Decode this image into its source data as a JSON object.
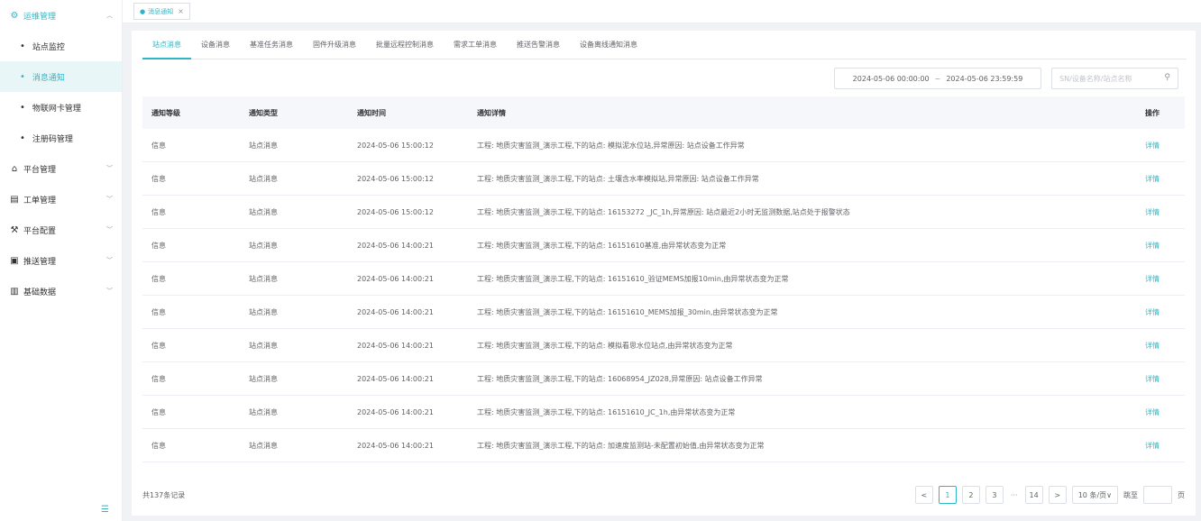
{
  "sidebar": {
    "groups": [
      {
        "label": "运维管理",
        "icon": "gear-icon",
        "open": true,
        "items": [
          {
            "label": "站点监控",
            "active": false
          },
          {
            "label": "消息通知",
            "active": true
          },
          {
            "label": "物联网卡管理",
            "active": false
          },
          {
            "label": "注册码管理",
            "active": false
          }
        ]
      },
      {
        "label": "平台管理",
        "icon": "platform-icon"
      },
      {
        "label": "工单管理",
        "icon": "workorder-icon"
      },
      {
        "label": "平台配置",
        "icon": "config-icon"
      },
      {
        "label": "推送管理",
        "icon": "push-icon"
      },
      {
        "label": "基础数据",
        "icon": "clipboard-icon"
      }
    ],
    "collapse_icon": "collapse-icon"
  },
  "tags": [
    {
      "label": "消息通知",
      "close": "×"
    }
  ],
  "tabs": [
    "站点消息",
    "设备消息",
    "基准任务消息",
    "固件升级消息",
    "批量远程控制消息",
    "需求工单消息",
    "推送告警消息",
    "设备离线通知消息"
  ],
  "filters": {
    "date_start": "2024-05-06 00:00:00",
    "date_sep": "~",
    "date_end": "2024-05-06 23:59:59",
    "search_placeholder": "SN/设备名称/站点名称"
  },
  "table": {
    "headers": {
      "level": "通知等级",
      "type": "通知类型",
      "time": "通知时间",
      "detail": "通知详情",
      "op": "操作"
    },
    "rows": [
      {
        "level": "信息",
        "type": "站点消息",
        "time": "2024-05-06 15:00:12",
        "detail": "工程: 地质灾害监测_演示工程,下的站点: 模拟泥水位站,异常原因: 站点设备工作异常",
        "op": "详情"
      },
      {
        "level": "信息",
        "type": "站点消息",
        "time": "2024-05-06 15:00:12",
        "detail": "工程: 地质灾害监测_演示工程,下的站点: 土壤含水率模拟站,异常原因: 站点设备工作异常",
        "op": "详情"
      },
      {
        "level": "信息",
        "type": "站点消息",
        "time": "2024-05-06 15:00:12",
        "detail": "工程: 地质灾害监测_演示工程,下的站点: 16153272 _JC_1h,异常原因: 站点最近2小时无监测数据,站点处于报警状态",
        "op": "详情"
      },
      {
        "level": "信息",
        "type": "站点消息",
        "time": "2024-05-06 14:00:21",
        "detail": "工程: 地质灾害监测_演示工程,下的站点: 16151610基准,由异常状态变为正常",
        "op": "详情"
      },
      {
        "level": "信息",
        "type": "站点消息",
        "time": "2024-05-06 14:00:21",
        "detail": "工程: 地质灾害监测_演示工程,下的站点: 16151610_验证MEMS加报10min,由异常状态变为正常",
        "op": "详情"
      },
      {
        "level": "信息",
        "type": "站点消息",
        "time": "2024-05-06 14:00:21",
        "detail": "工程: 地质灾害监测_演示工程,下的站点: 16151610_MEMS加报_30min,由异常状态变为正常",
        "op": "详情"
      },
      {
        "level": "信息",
        "type": "站点消息",
        "time": "2024-05-06 14:00:21",
        "detail": "工程: 地质灾害监测_演示工程,下的站点: 模拟看思水位站点,由异常状态变为正常",
        "op": "详情"
      },
      {
        "level": "信息",
        "type": "站点消息",
        "time": "2024-05-06 14:00:21",
        "detail": "工程: 地质灾害监测_演示工程,下的站点: 16068954_JZ028,异常原因: 站点设备工作异常",
        "op": "详情"
      },
      {
        "level": "信息",
        "type": "站点消息",
        "time": "2024-05-06 14:00:21",
        "detail": "工程: 地质灾害监测_演示工程,下的站点: 16151610_JC_1h,由异常状态变为正常",
        "op": "详情"
      },
      {
        "level": "信息",
        "type": "站点消息",
        "time": "2024-05-06 14:00:21",
        "detail": "工程: 地质灾害监测_演示工程,下的站点: 加速度监测站-未配置初始值,由异常状态变为正常",
        "op": "详情"
      }
    ]
  },
  "pagination": {
    "total_text": "共137条记录",
    "prev": "<",
    "pages": [
      "1",
      "2",
      "3"
    ],
    "ellipsis": "···",
    "last": "14",
    "next": ">",
    "page_size": "10 条/页∨",
    "jump_label": "跳至",
    "jump_suffix": "页"
  },
  "colors": {
    "accent": "#2db7c6",
    "active_bg": "#e8f6f8"
  }
}
